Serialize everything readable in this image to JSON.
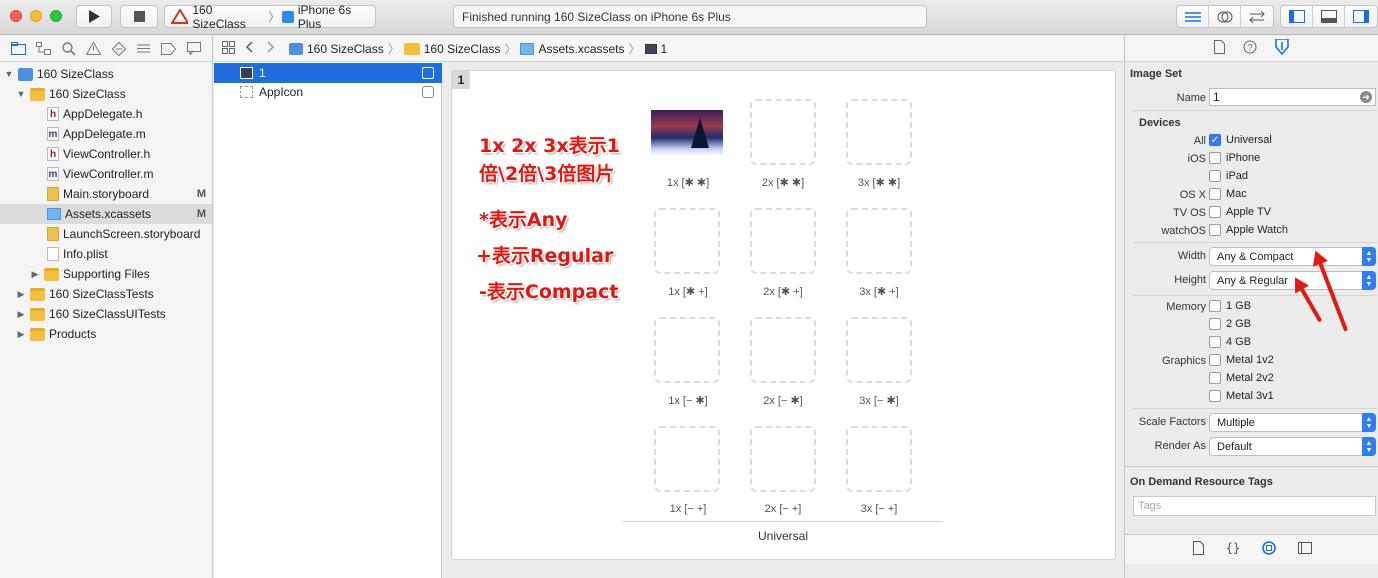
{
  "toolbar": {
    "scheme_name": "160 SizeClass",
    "scheme_sep": "〉",
    "device_name": "iPhone 6s Plus",
    "status_text": "Finished running 160 SizeClass on iPhone 6s Plus"
  },
  "navigator": {
    "items": [
      {
        "label": "160 SizeClass",
        "badge": ""
      },
      {
        "label": "160 SizeClass",
        "badge": ""
      },
      {
        "label": "AppDelegate.h",
        "badge": "",
        "icon_letter": "h"
      },
      {
        "label": "AppDelegate.m",
        "badge": "",
        "icon_letter": "m"
      },
      {
        "label": "ViewController.h",
        "badge": "",
        "icon_letter": "h"
      },
      {
        "label": "ViewController.m",
        "badge": "",
        "icon_letter": "m"
      },
      {
        "label": "Main.storyboard",
        "badge": "M"
      },
      {
        "label": "Assets.xcassets",
        "badge": "M"
      },
      {
        "label": "LaunchScreen.storyboard",
        "badge": ""
      },
      {
        "label": "Info.plist",
        "badge": ""
      },
      {
        "label": "Supporting Files",
        "badge": ""
      },
      {
        "label": "160 SizeClassTests",
        "badge": ""
      },
      {
        "label": "160 SizeClassUITests",
        "badge": ""
      },
      {
        "label": "Products",
        "badge": ""
      }
    ]
  },
  "jumpbar": {
    "crumbs": [
      "160 SizeClass",
      "160 SizeClass",
      "Assets.xcassets",
      "1"
    ],
    "sep": "〉"
  },
  "assets": {
    "items": [
      {
        "label": "1"
      },
      {
        "label": "AppIcon"
      }
    ]
  },
  "canvas": {
    "set_title": "1",
    "slot_labels": [
      "1x [✱ ✱]",
      "2x [✱ ✱]",
      "3x [✱ ✱]",
      "1x [✱ +]",
      "2x [✱ +]",
      "3x [✱ +]",
      "1x [− ✱]",
      "2x [− ✱]",
      "3x [− ✱]",
      "1x [− +]",
      "2x [− +]",
      "3x [− +]"
    ],
    "group_label": "Universal",
    "annotations": {
      "line1": "1x 2x 3x表示1",
      "line2": "倍\\2倍\\3倍图片",
      "line3": "*表示Any",
      "line4": "+表示Regular",
      "line5": "-表示Compact"
    }
  },
  "inspector": {
    "image_set_title": "Image Set",
    "name_label": "Name",
    "name_value": "1",
    "devices_title": "Devices",
    "all_label": "All",
    "universal": "Universal",
    "ios_label": "iOS",
    "iphone": "iPhone",
    "ipad": "iPad",
    "osx_label": "OS X",
    "mac": "Mac",
    "tvos_label": "TV OS",
    "apple_tv": "Apple TV",
    "watchos_label": "watchOS",
    "apple_watch": "Apple Watch",
    "width_label": "Width",
    "width_value": "Any & Compact",
    "height_label": "Height",
    "height_value": "Any & Regular",
    "memory_label": "Memory",
    "mem1": "1 GB",
    "mem2": "2 GB",
    "mem4": "4 GB",
    "graphics_label": "Graphics",
    "metal1": "Metal 1v2",
    "metal2": "Metal 2v2",
    "metal3": "Metal 3v1",
    "scale_label": "Scale Factors",
    "scale_value": "Multiple",
    "render_label": "Render As",
    "render_value": "Default",
    "odr_title": "On Demand Resource Tags",
    "tags_placeholder": "Tags"
  },
  "colors": {
    "selection": "#1d6ee0",
    "annotation_red": "#e3170f",
    "accent_blue": "#2f7df6"
  }
}
